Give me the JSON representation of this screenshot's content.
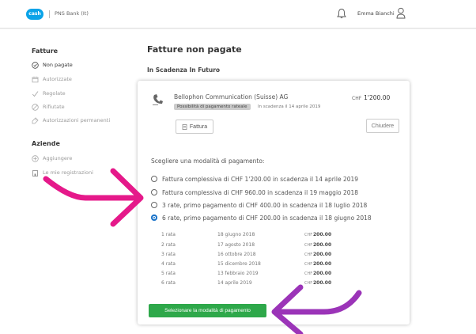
{
  "header": {
    "logo_text": "cash",
    "bank_name": "PNS Bank (It)",
    "user_name": "Emma Bianchi"
  },
  "sidebar": {
    "section1_title": "Fatture",
    "items": [
      {
        "label": "Non pagate",
        "icon": "check-circle-icon",
        "active": true
      },
      {
        "label": "Autorizzate",
        "icon": "calendar-icon",
        "active": false
      },
      {
        "label": "Regolate",
        "icon": "checkmark-icon",
        "active": false
      },
      {
        "label": "Rifiutate",
        "icon": "block-icon",
        "active": false
      },
      {
        "label": "Autorizzazioni permanenti",
        "icon": "tag-icon",
        "active": false
      }
    ],
    "section2_title": "Aziende",
    "items2": [
      {
        "label": "Aggiungere",
        "icon": "plus-circle-icon"
      },
      {
        "label": "Le mie registrazioni",
        "icon": "building-icon"
      }
    ]
  },
  "main": {
    "title": "Fatture non pagate",
    "subtitle": "In Scadenza In Futuro",
    "bill": {
      "biller": "Bellophon Communication (Suisse) AG",
      "currency": "CHF",
      "amount": "1'200.00",
      "badge": "Possibilità di pagamento rateale",
      "due": "In scadenza il 14 aprile 2019",
      "fattura_label": "Fattura",
      "close_label": "Chiudere"
    },
    "choose_label": "Scegliere una modalità di pagamento:",
    "options": [
      {
        "label": "Fattura complessiva di CHF 1'200.00 in scadenza il 14 aprile 2019",
        "selected": false
      },
      {
        "label": "Fattura complessiva di CHF 960.00 in scadenza il 19 maggio 2018",
        "selected": false
      },
      {
        "label": "3 rate, primo pagamento di CHF 400.00 in scadenza il 18 luglio 2018",
        "selected": false
      },
      {
        "label": "6 rate, primo pagamento di CHF 200.00 in scadenza il 18 giugno 2018",
        "selected": true
      }
    ],
    "installments": [
      {
        "n": "1 rata",
        "date": "18 giugno 2018",
        "cur": "CHF",
        "amount": "200.00"
      },
      {
        "n": "2 rata",
        "date": "17 agosto 2018",
        "cur": "CHF",
        "amount": "200.00"
      },
      {
        "n": "3 rata",
        "date": "16 ottobre 2018",
        "cur": "CHF",
        "amount": "200.00"
      },
      {
        "n": "4 rata",
        "date": "15 dicembre 2018",
        "cur": "CHF",
        "amount": "200.00"
      },
      {
        "n": "5 rata",
        "date": "13 febbraio 2019",
        "cur": "CHF",
        "amount": "200.00"
      },
      {
        "n": "6 rata",
        "date": "14 aprile 2019",
        "cur": "CHF",
        "amount": "200.00"
      }
    ],
    "submit_label": "Selezionare la modalità di pagamento"
  },
  "colors": {
    "arrow_pink": "#e5198a",
    "arrow_purple": "#9b34b8",
    "accent_blue": "#0aa3e8",
    "submit_green": "#2ea84a"
  }
}
